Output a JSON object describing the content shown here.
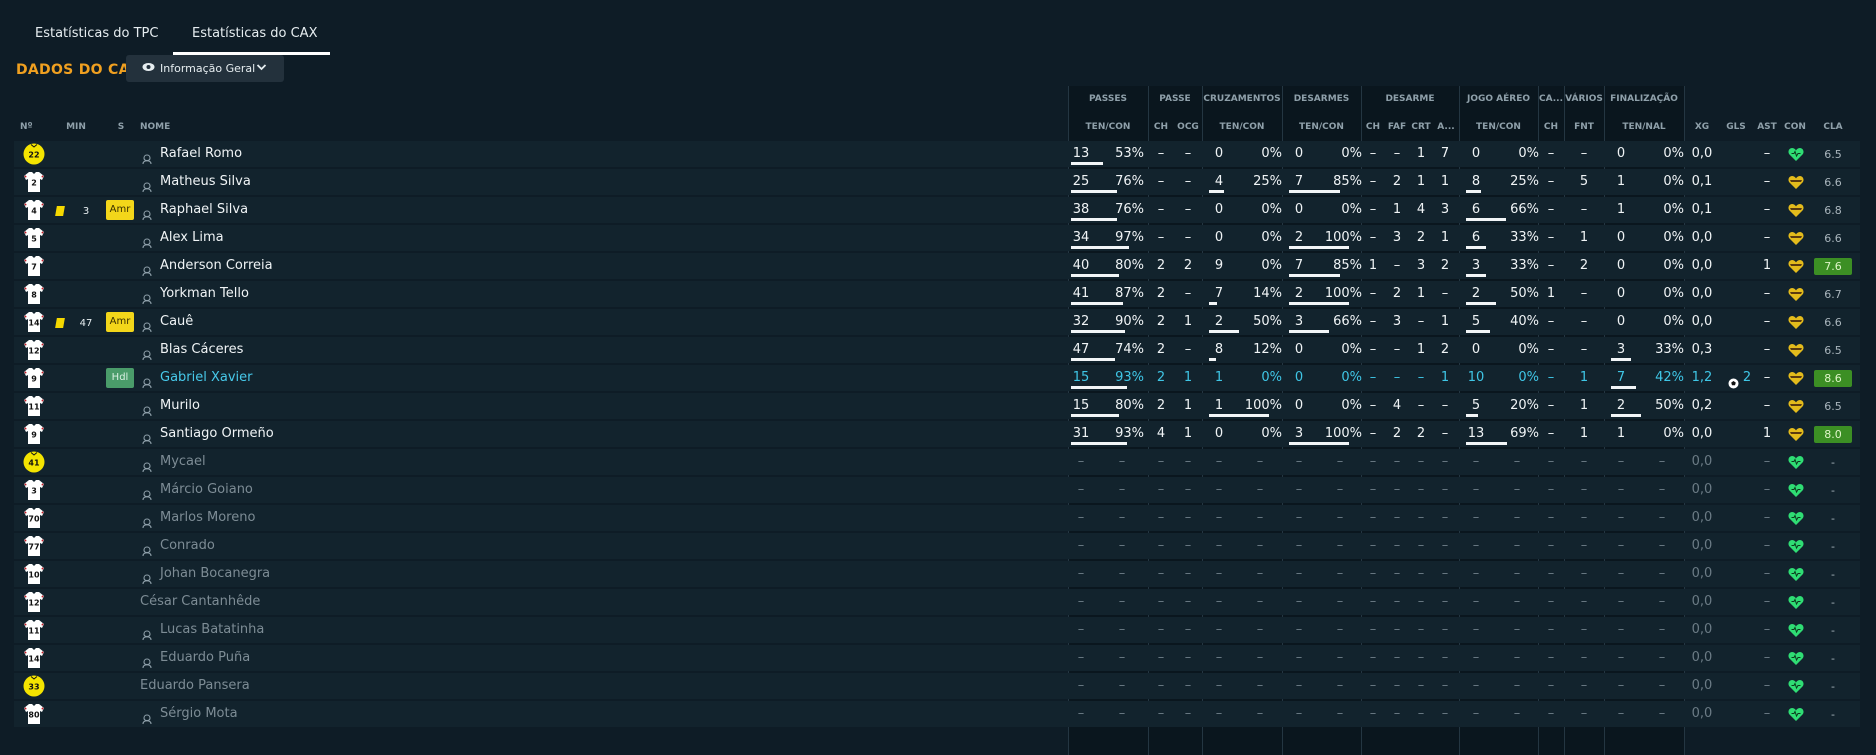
{
  "tabs": [
    {
      "label": "Estatísticas do TPC"
    },
    {
      "label": "Estatísticas do CAX"
    }
  ],
  "section_title": "DADOS DO CAX",
  "view_selector": {
    "label": "Informação Geral"
  },
  "groups": {
    "passes": "PASSES",
    "passe": "PASSE",
    "cruzamentos": "CRUZAMENTOS",
    "desarmes": "DESARMES",
    "desarme": "DESARME",
    "jogo_aereo": "JOGO AÉREO",
    "ca": "CA...",
    "varios": "VÁRIOS",
    "finalizacao": "FINALIZAÇÃO"
  },
  "headers": {
    "no": "Nº",
    "min": "MIN",
    "s": "S",
    "nome": "NOME",
    "passes": "TEN/CON",
    "passe_ch": "CH",
    "passe_ocg": "OCG",
    "cruz": "TEN/CON",
    "desarmes": "TEN/CON",
    "des_ch": "CH",
    "des_faf": "FAF",
    "des_crt": "CRT",
    "des_a": "A...",
    "aereo": "TEN/CON",
    "ca_ch": "CH",
    "fnt": "FNT",
    "finalizacao": "TEN/NAL",
    "xg": "XG",
    "gls": "GLS",
    "ast": "AST",
    "con": "CON",
    "cla": "CLA"
  },
  "colors": {
    "accent": "#f0a020",
    "rating_good": "#3c8f24",
    "condition_green": "#2fdd74",
    "condition_yellow": "#e3bb1c",
    "highlight_blue": "#47c9ea"
  },
  "players": [
    {
      "num": "22",
      "shirt": "gk-yellow",
      "card": "",
      "min": "",
      "sub_badge": "",
      "name": "Rafael Romo",
      "state": "played",
      "person_icon": true,
      "passes": [
        "13",
        "53%"
      ],
      "passes_ratio": 0.53,
      "passe": [
        "–",
        "–"
      ],
      "cruz": [
        "0",
        "0%"
      ],
      "cruz_ratio": 0,
      "desarmes": [
        "0",
        "0%"
      ],
      "desarmes_ratio": 0,
      "desarme": [
        "–",
        "–",
        "1",
        "7"
      ],
      "aereo": [
        "0",
        "0%"
      ],
      "aereo_ratio": 0,
      "ca": "–",
      "fnt": "–",
      "fin": [
        "0",
        "0%"
      ],
      "fin_ratio": 0,
      "xg": "0,0",
      "gls": "",
      "ast": "–",
      "con": "green",
      "cla": "6.5",
      "cla_good": false
    },
    {
      "num": "2",
      "shirt": "outfield",
      "card": "",
      "min": "",
      "sub_badge": "",
      "name": "Matheus Silva",
      "state": "played",
      "person_icon": true,
      "passes": [
        "25",
        "76%"
      ],
      "passes_ratio": 0.76,
      "passe": [
        "–",
        "–"
      ],
      "cruz": [
        "4",
        "25%"
      ],
      "cruz_ratio": 0.25,
      "desarmes": [
        "7",
        "85%"
      ],
      "desarmes_ratio": 0.85,
      "desarme": [
        "–",
        "2",
        "1",
        "1"
      ],
      "aereo": [
        "8",
        "25%"
      ],
      "aereo_ratio": 0.25,
      "ca": "–",
      "fnt": "5",
      "fin": [
        "1",
        "0%"
      ],
      "fin_ratio": 0,
      "xg": "0,1",
      "gls": "",
      "ast": "–",
      "con": "yellow",
      "cla": "6.6",
      "cla_good": false
    },
    {
      "num": "4",
      "shirt": "outfield",
      "card": "yellow",
      "min": "3",
      "sub_badge": "Amr",
      "name": "Raphael Silva",
      "state": "played",
      "person_icon": true,
      "passes": [
        "38",
        "76%"
      ],
      "passes_ratio": 0.76,
      "passe": [
        "–",
        "–"
      ],
      "cruz": [
        "0",
        "0%"
      ],
      "cruz_ratio": 0,
      "desarmes": [
        "0",
        "0%"
      ],
      "desarmes_ratio": 0,
      "desarme": [
        "–",
        "1",
        "4",
        "3"
      ],
      "aereo": [
        "6",
        "66%"
      ],
      "aereo_ratio": 0.66,
      "ca": "–",
      "fnt": "–",
      "fin": [
        "1",
        "0%"
      ],
      "fin_ratio": 0,
      "xg": "0,1",
      "gls": "",
      "ast": "–",
      "con": "yellow",
      "cla": "6.8",
      "cla_good": false
    },
    {
      "num": "5",
      "shirt": "outfield",
      "card": "",
      "min": "",
      "sub_badge": "",
      "name": "Alex Lima",
      "state": "played",
      "person_icon": true,
      "passes": [
        "34",
        "97%"
      ],
      "passes_ratio": 0.97,
      "passe": [
        "–",
        "–"
      ],
      "cruz": [
        "0",
        "0%"
      ],
      "cruz_ratio": 0,
      "desarmes": [
        "2",
        "100%"
      ],
      "desarmes_ratio": 1,
      "desarme": [
        "–",
        "3",
        "2",
        "1"
      ],
      "aereo": [
        "6",
        "33%"
      ],
      "aereo_ratio": 0.33,
      "ca": "–",
      "fnt": "1",
      "fin": [
        "0",
        "0%"
      ],
      "fin_ratio": 0,
      "xg": "0,0",
      "gls": "",
      "ast": "–",
      "con": "yellow",
      "cla": "6.6",
      "cla_good": false
    },
    {
      "num": "7",
      "shirt": "outfield",
      "card": "",
      "min": "",
      "sub_badge": "",
      "name": "Anderson Correia",
      "state": "played",
      "person_icon": true,
      "passes": [
        "40",
        "80%"
      ],
      "passes_ratio": 0.8,
      "passe": [
        "2",
        "2"
      ],
      "cruz": [
        "9",
        "0%"
      ],
      "cruz_ratio": 0,
      "desarmes": [
        "7",
        "85%"
      ],
      "desarmes_ratio": 0.85,
      "desarme": [
        "1",
        "–",
        "3",
        "2"
      ],
      "aereo": [
        "3",
        "33%"
      ],
      "aereo_ratio": 0.33,
      "ca": "–",
      "fnt": "2",
      "fin": [
        "0",
        "0%"
      ],
      "fin_ratio": 0,
      "xg": "0,0",
      "gls": "",
      "ast": "1",
      "con": "yellow",
      "cla": "7.6",
      "cla_good": true
    },
    {
      "num": "8",
      "shirt": "outfield",
      "card": "",
      "min": "",
      "sub_badge": "",
      "name": "Yorkman Tello",
      "state": "played",
      "person_icon": true,
      "passes": [
        "41",
        "87%"
      ],
      "passes_ratio": 0.87,
      "passe": [
        "2",
        "–"
      ],
      "cruz": [
        "7",
        "14%"
      ],
      "cruz_ratio": 0.14,
      "desarmes": [
        "2",
        "100%"
      ],
      "desarmes_ratio": 1,
      "desarme": [
        "–",
        "2",
        "1",
        "–"
      ],
      "aereo": [
        "2",
        "50%"
      ],
      "aereo_ratio": 0.5,
      "ca": "1",
      "fnt": "–",
      "fin": [
        "0",
        "0%"
      ],
      "fin_ratio": 0,
      "xg": "0,0",
      "gls": "",
      "ast": "–",
      "con": "yellow",
      "cla": "6.7",
      "cla_good": false
    },
    {
      "num": "14",
      "shirt": "outfield",
      "card": "yellow",
      "min": "47",
      "sub_badge": "Amr",
      "name": "Cauê",
      "state": "played",
      "person_icon": true,
      "passes": [
        "32",
        "90%"
      ],
      "passes_ratio": 0.9,
      "passe": [
        "2",
        "1"
      ],
      "cruz": [
        "2",
        "50%"
      ],
      "cruz_ratio": 0.5,
      "desarmes": [
        "3",
        "66%"
      ],
      "desarmes_ratio": 0.66,
      "desarme": [
        "–",
        "3",
        "–",
        "1"
      ],
      "aereo": [
        "5",
        "40%"
      ],
      "aereo_ratio": 0.4,
      "ca": "–",
      "fnt": "–",
      "fin": [
        "0",
        "0%"
      ],
      "fin_ratio": 0,
      "xg": "0,0",
      "gls": "",
      "ast": "–",
      "con": "yellow",
      "cla": "6.6",
      "cla_good": false
    },
    {
      "num": "12",
      "shirt": "outfield",
      "card": "",
      "min": "",
      "sub_badge": "",
      "name": "Blas Cáceres",
      "state": "played",
      "person_icon": true,
      "passes": [
        "47",
        "74%"
      ],
      "passes_ratio": 0.74,
      "passe": [
        "2",
        "–"
      ],
      "cruz": [
        "8",
        "12%"
      ],
      "cruz_ratio": 0.12,
      "desarmes": [
        "0",
        "0%"
      ],
      "desarmes_ratio": 0,
      "desarme": [
        "–",
        "–",
        "1",
        "2"
      ],
      "aereo": [
        "0",
        "0%"
      ],
      "aereo_ratio": 0,
      "ca": "–",
      "fnt": "–",
      "fin": [
        "3",
        "33%"
      ],
      "fin_ratio": 0.33,
      "xg": "0,3",
      "gls": "",
      "ast": "–",
      "con": "yellow",
      "cla": "6.5",
      "cla_good": false
    },
    {
      "num": "9",
      "shirt": "outfield",
      "card": "",
      "min": "",
      "sub_badge": "Hdl",
      "name": "Gabriel Xavier",
      "state": "highlight",
      "person_icon": true,
      "passes": [
        "15",
        "93%"
      ],
      "passes_ratio": 0.93,
      "passe": [
        "2",
        "1"
      ],
      "cruz": [
        "1",
        "0%"
      ],
      "cruz_ratio": 0,
      "desarmes": [
        "0",
        "0%"
      ],
      "desarmes_ratio": 0,
      "desarme": [
        "–",
        "–",
        "–",
        "1"
      ],
      "aereo": [
        "10",
        "0%"
      ],
      "aereo_ratio": 0,
      "ca": "–",
      "fnt": "1",
      "fin": [
        "7",
        "42%"
      ],
      "fin_ratio": 0.42,
      "xg": "1,2",
      "gls": "2",
      "ast": "–",
      "con": "yellow",
      "cla": "8.6",
      "cla_good": true
    },
    {
      "num": "11",
      "shirt": "outfield",
      "card": "",
      "min": "",
      "sub_badge": "",
      "name": "Murilo",
      "state": "played",
      "person_icon": true,
      "passes": [
        "15",
        "80%"
      ],
      "passes_ratio": 0.8,
      "passe": [
        "2",
        "1"
      ],
      "cruz": [
        "1",
        "100%"
      ],
      "cruz_ratio": 1,
      "desarmes": [
        "0",
        "0%"
      ],
      "desarmes_ratio": 0,
      "desarme": [
        "–",
        "4",
        "–",
        "–"
      ],
      "aereo": [
        "5",
        "20%"
      ],
      "aereo_ratio": 0.2,
      "ca": "–",
      "fnt": "1",
      "fin": [
        "2",
        "50%"
      ],
      "fin_ratio": 0.5,
      "xg": "0,2",
      "gls": "",
      "ast": "–",
      "con": "yellow",
      "cla": "6.5",
      "cla_good": false
    },
    {
      "num": "9",
      "shirt": "outfield",
      "card": "",
      "min": "",
      "sub_badge": "",
      "name": "Santiago Ormeño",
      "state": "played",
      "person_icon": true,
      "passes": [
        "31",
        "93%"
      ],
      "passes_ratio": 0.93,
      "passe": [
        "4",
        "1"
      ],
      "cruz": [
        "0",
        "0%"
      ],
      "cruz_ratio": 0,
      "desarmes": [
        "3",
        "100%"
      ],
      "desarmes_ratio": 1,
      "desarme": [
        "–",
        "2",
        "2",
        "–"
      ],
      "aereo": [
        "13",
        "69%"
      ],
      "aereo_ratio": 0.69,
      "ca": "–",
      "fnt": "1",
      "fin": [
        "1",
        "0%"
      ],
      "fin_ratio": 0,
      "xg": "0,0",
      "gls": "",
      "ast": "1",
      "con": "yellow",
      "cla": "8.0",
      "cla_good": true
    },
    {
      "num": "41",
      "shirt": "gk-yellow",
      "card": "",
      "min": "",
      "sub_badge": "",
      "name": "Mycael",
      "state": "unused",
      "person_icon": true,
      "xg": "0,0",
      "ast": "–",
      "con": "green",
      "cla": "-"
    },
    {
      "num": "3",
      "shirt": "outfield",
      "card": "",
      "min": "",
      "sub_badge": "",
      "name": "Márcio Goiano",
      "state": "unused",
      "person_icon": true,
      "xg": "0,0",
      "ast": "–",
      "con": "green",
      "cla": "-"
    },
    {
      "num": "70",
      "shirt": "outfield",
      "card": "",
      "min": "",
      "sub_badge": "",
      "name": "Marlos Moreno",
      "state": "unused",
      "person_icon": true,
      "xg": "0,0",
      "ast": "–",
      "con": "green",
      "cla": "-"
    },
    {
      "num": "77",
      "shirt": "outfield",
      "card": "",
      "min": "",
      "sub_badge": "",
      "name": "Conrado",
      "state": "unused",
      "person_icon": true,
      "xg": "0,0",
      "ast": "–",
      "con": "green",
      "cla": "-"
    },
    {
      "num": "10",
      "shirt": "outfield",
      "card": "",
      "min": "",
      "sub_badge": "",
      "name": "Johan Bocanegra",
      "state": "unused",
      "person_icon": true,
      "xg": "0,0",
      "ast": "–",
      "con": "green",
      "cla": "-"
    },
    {
      "num": "12",
      "shirt": "outfield",
      "card": "",
      "min": "",
      "sub_badge": "",
      "name": "César Cantanhêde",
      "state": "unused",
      "person_icon": false,
      "xg": "0,0",
      "ast": "–",
      "con": "green",
      "cla": "-"
    },
    {
      "num": "11",
      "shirt": "outfield",
      "card": "",
      "min": "",
      "sub_badge": "",
      "name": "Lucas Batatinha",
      "state": "unused",
      "person_icon": true,
      "xg": "0,0",
      "ast": "–",
      "con": "green",
      "cla": "-"
    },
    {
      "num": "14",
      "shirt": "outfield",
      "card": "",
      "min": "",
      "sub_badge": "",
      "name": "Eduardo Puña",
      "state": "unused",
      "person_icon": true,
      "xg": "0,0",
      "ast": "–",
      "con": "green",
      "cla": "-"
    },
    {
      "num": "33",
      "shirt": "gk-yellow",
      "card": "",
      "min": "",
      "sub_badge": "",
      "name": "Eduardo Pansera",
      "state": "unused",
      "person_icon": false,
      "xg": "0,0",
      "ast": "–",
      "con": "green",
      "cla": "-"
    },
    {
      "num": "80",
      "shirt": "outfield",
      "card": "",
      "min": "",
      "sub_badge": "",
      "name": "Sérgio Mota",
      "state": "unused",
      "person_icon": true,
      "xg": "0,0",
      "ast": "–",
      "con": "green",
      "cla": "-"
    }
  ]
}
